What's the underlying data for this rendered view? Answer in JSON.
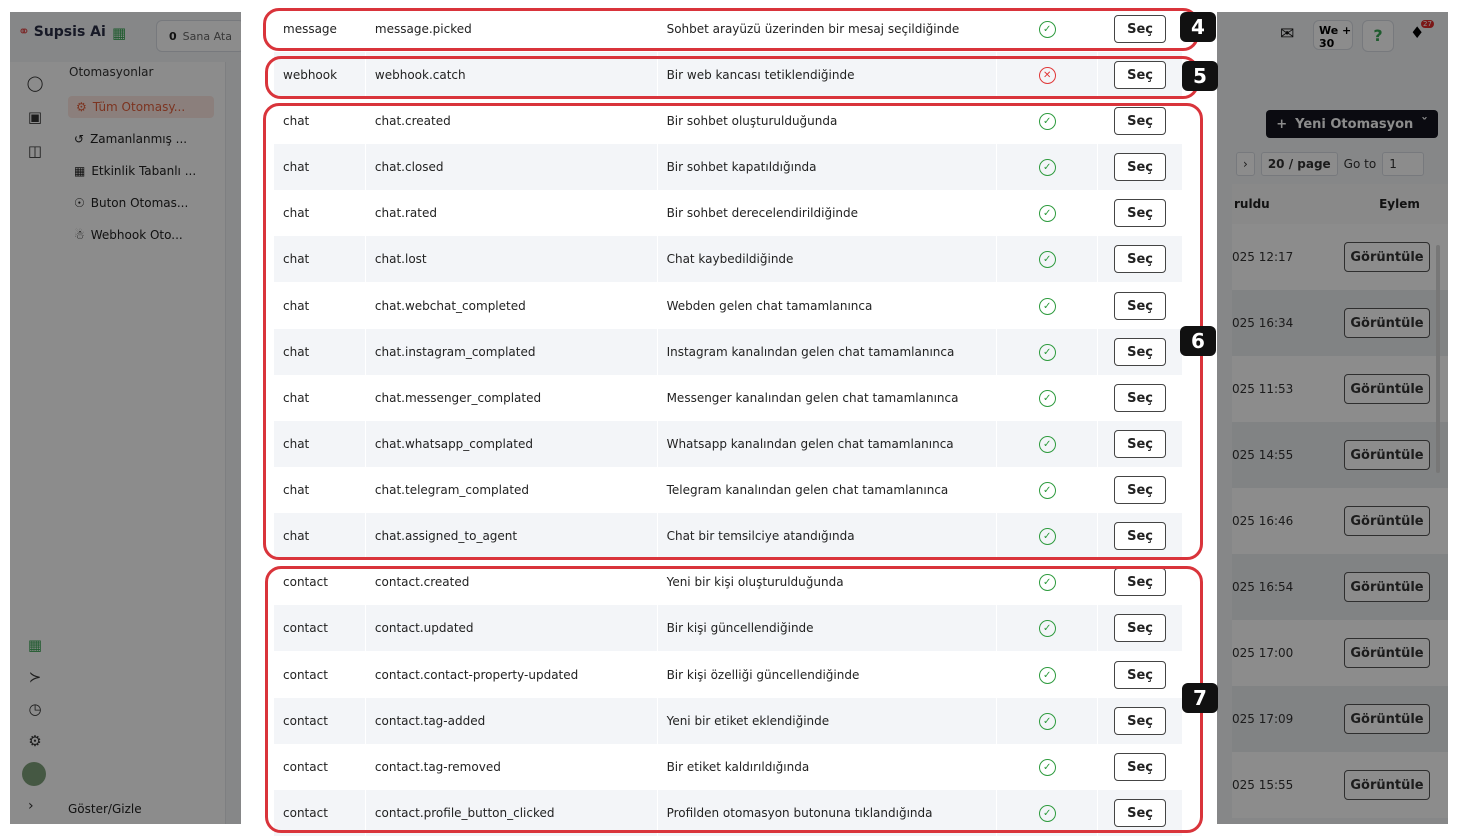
{
  "app": {
    "brand": "Supsis Ai",
    "credit": {
      "count": "0",
      "label": "Sana Ata"
    },
    "sidebar_title": "Otomasyonlar",
    "sidebar_items": [
      {
        "label": "Tüm Otomasy..."
      },
      {
        "label": "Zamanlanmış ..."
      },
      {
        "label": "Etkinlik Tabanlı ..."
      },
      {
        "label": "Buton Otomas..."
      },
      {
        "label": "Webhook Oto..."
      }
    ],
    "toggle_label": "Göster/Gizle",
    "we_label": "We",
    "we_count": "30",
    "notif_count": "27",
    "new_button": "Yeni Otomasyon",
    "pager": {
      "size": "20 / page",
      "goto_label": "Go to",
      "goto_value": "1"
    },
    "table": {
      "col_created": "ruldu",
      "col_action": "Eylem",
      "rows": [
        {
          "date": "025 12:17",
          "action": "Görüntüle"
        },
        {
          "date": "025 16:34",
          "action": "Görüntüle"
        },
        {
          "date": "025 11:53",
          "action": "Görüntüle"
        },
        {
          "date": "025 14:55",
          "action": "Görüntüle"
        },
        {
          "date": "025 16:46",
          "action": "Görüntüle"
        },
        {
          "date": "025 16:54",
          "action": "Görüntüle"
        },
        {
          "date": "025 17:00",
          "action": "Görüntüle"
        },
        {
          "date": "025 17:09",
          "action": "Görüntüle"
        },
        {
          "date": "025 15:55",
          "action": "Görüntüle"
        }
      ]
    }
  },
  "modal": {
    "select_label": "Seç",
    "events": [
      {
        "cat": "message",
        "event": "message.picked",
        "desc": "Sohbet arayüzü üzerinden bir mesaj seçildiğinde",
        "status": "ok"
      },
      {
        "cat": "webhook",
        "event": "webhook.catch",
        "desc": "Bir web kancası tetiklendiğinde",
        "status": "bad"
      },
      {
        "cat": "chat",
        "event": "chat.created",
        "desc": "Bir sohbet oluşturulduğunda",
        "status": "ok"
      },
      {
        "cat": "chat",
        "event": "chat.closed",
        "desc": "Bir sohbet kapatıldığında",
        "status": "ok"
      },
      {
        "cat": "chat",
        "event": "chat.rated",
        "desc": "Bir sohbet derecelendirildiğinde",
        "status": "ok"
      },
      {
        "cat": "chat",
        "event": "chat.lost",
        "desc": "Chat kaybedildiğinde",
        "status": "ok"
      },
      {
        "cat": "chat",
        "event": "chat.webchat_completed",
        "desc": "Webden gelen chat tamamlanınca",
        "status": "ok"
      },
      {
        "cat": "chat",
        "event": "chat.instagram_complated",
        "desc": "Instagram kanalından gelen chat tamamlanınca",
        "status": "ok"
      },
      {
        "cat": "chat",
        "event": "chat.messenger_complated",
        "desc": "Messenger kanalından gelen chat tamamlanınca",
        "status": "ok"
      },
      {
        "cat": "chat",
        "event": "chat.whatsapp_complated",
        "desc": "Whatsapp kanalından gelen chat tamamlanınca",
        "status": "ok"
      },
      {
        "cat": "chat",
        "event": "chat.telegram_complated",
        "desc": "Telegram kanalından gelen chat tamamlanınca",
        "status": "ok"
      },
      {
        "cat": "chat",
        "event": "chat.assigned_to_agent",
        "desc": "Chat bir temsilciye atandığında",
        "status": "ok"
      },
      {
        "cat": "contact",
        "event": "contact.created",
        "desc": "Yeni bir kişi oluşturulduğunda",
        "status": "ok"
      },
      {
        "cat": "contact",
        "event": "contact.updated",
        "desc": "Bir kişi güncellendiğinde",
        "status": "ok"
      },
      {
        "cat": "contact",
        "event": "contact.contact-property-updated",
        "desc": "Bir kişi özelliği güncellendiğinde",
        "status": "ok"
      },
      {
        "cat": "contact",
        "event": "contact.tag-added",
        "desc": "Yeni bir etiket eklendiğinde",
        "status": "ok"
      },
      {
        "cat": "contact",
        "event": "contact.tag-removed",
        "desc": "Bir etiket kaldırıldığında",
        "status": "ok"
      },
      {
        "cat": "contact",
        "event": "contact.profile_button_clicked",
        "desc": "Profilden otomasyon butonuna tıklandığında",
        "status": "ok"
      }
    ]
  },
  "annotations": [
    {
      "label": "4"
    },
    {
      "label": "5"
    },
    {
      "label": "6"
    },
    {
      "label": "7"
    }
  ],
  "colors": {
    "accent": "#d9343b",
    "success": "#2e9b3e",
    "danger": "#e03838",
    "brand": "#e2603c"
  }
}
